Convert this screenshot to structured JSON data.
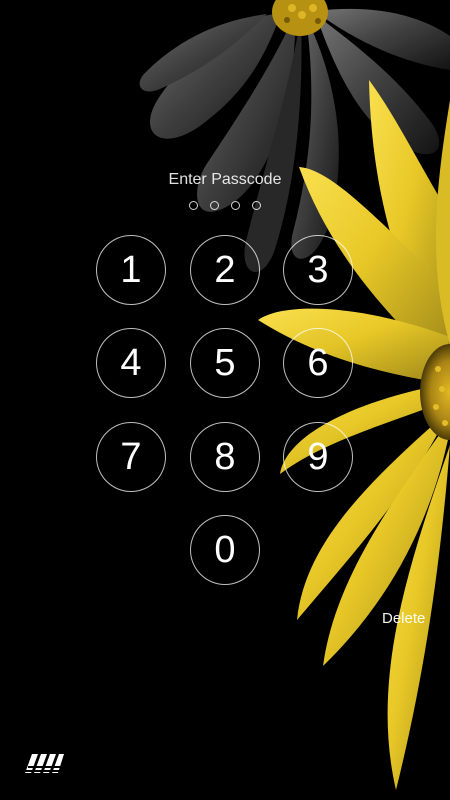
{
  "lock_screen": {
    "title": "Enter Passcode",
    "passcode_slots": 4,
    "keys": [
      {
        "label": "1"
      },
      {
        "label": "2"
      },
      {
        "label": "3"
      },
      {
        "label": "4"
      },
      {
        "label": "5"
      },
      {
        "label": "6"
      },
      {
        "label": "7"
      },
      {
        "label": "8"
      },
      {
        "label": "9"
      },
      {
        "label": "0"
      }
    ],
    "delete_label": "Delete"
  },
  "colors": {
    "background": "#000000",
    "flower_yellow": "#f2d52f",
    "flower_gray": "#6f6f6f"
  },
  "icons": {
    "logo": "striped-logo-icon"
  }
}
